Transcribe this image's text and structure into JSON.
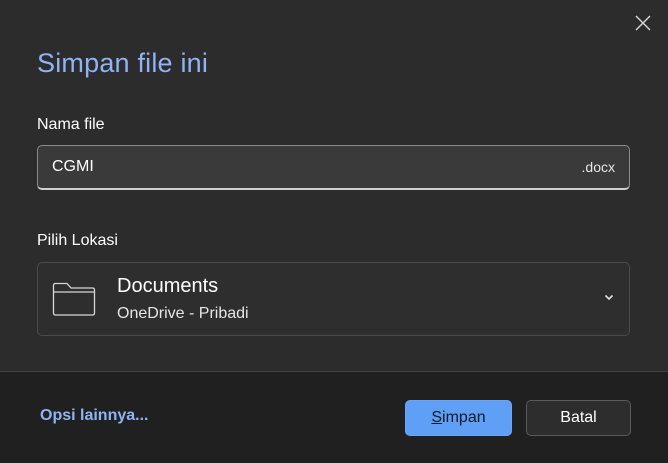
{
  "dialog": {
    "title": "Simpan file ini",
    "close_icon": "close-icon"
  },
  "filename": {
    "label": "Nama file",
    "value": "CGMI",
    "extension": ".docx"
  },
  "location": {
    "label": "Pilih Lokasi",
    "name": "Documents",
    "subtitle": "OneDrive - Pribadi",
    "icon": "folder-icon",
    "dropdown_icon": "chevron-down-icon"
  },
  "footer": {
    "more_options": "Opsi lainnya...",
    "save_label_first": "S",
    "save_label_rest": "impan",
    "cancel_label": "Batal"
  },
  "colors": {
    "accent": "#8fb3f4",
    "primary_button": "#5f9ff5",
    "background": "#2c2c2c",
    "footer_background": "#202020"
  }
}
